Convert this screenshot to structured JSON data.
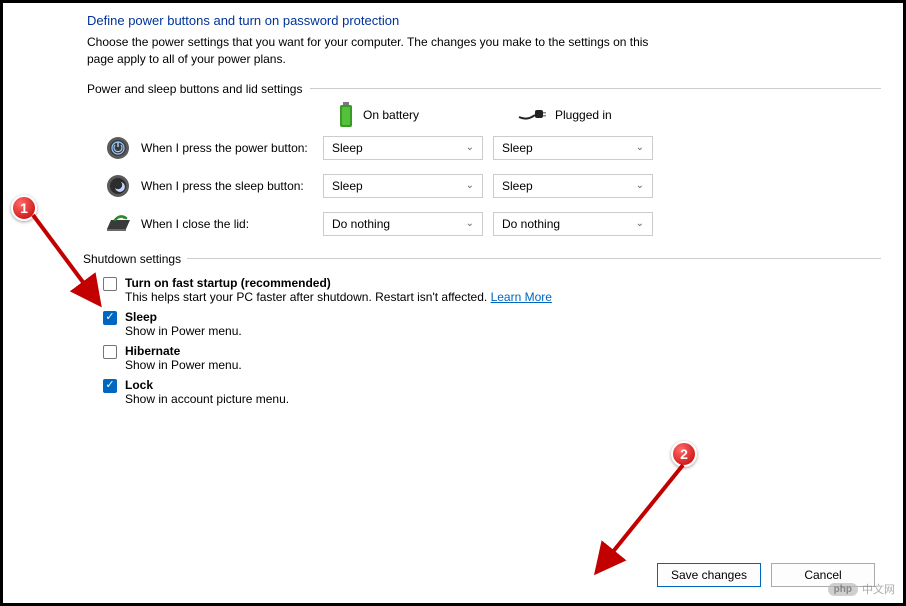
{
  "title": "Define power buttons and turn on password protection",
  "description": "Choose the power settings that you want for your computer. The changes you make to the settings on this page apply to all of your power plans.",
  "section1": {
    "label": "Power and sleep buttons and lid settings",
    "columns": {
      "battery": "On battery",
      "plugged": "Plugged in"
    },
    "rows": {
      "power": {
        "label": "When I press the power button:",
        "battery": "Sleep",
        "plugged": "Sleep"
      },
      "sleep": {
        "label": "When I press the sleep button:",
        "battery": "Sleep",
        "plugged": "Sleep"
      },
      "lid": {
        "label": "When I close the lid:",
        "battery": "Do nothing",
        "plugged": "Do nothing"
      }
    }
  },
  "shutdown": {
    "label": "Shutdown settings",
    "fast_startup": {
      "title": "Turn on fast startup (recommended)",
      "sub": "This helps start your PC faster after shutdown. Restart isn't affected. ",
      "learn_more": "Learn More"
    },
    "sleep": {
      "title": "Sleep",
      "sub": "Show in Power menu."
    },
    "hibernate": {
      "title": "Hibernate",
      "sub": "Show in Power menu."
    },
    "lock": {
      "title": "Lock",
      "sub": "Show in account picture menu."
    }
  },
  "buttons": {
    "save": "Save changes",
    "cancel": "Cancel"
  },
  "annotations": {
    "one": "1",
    "two": "2"
  },
  "watermark": {
    "pill": "php",
    "text": "中文网"
  }
}
